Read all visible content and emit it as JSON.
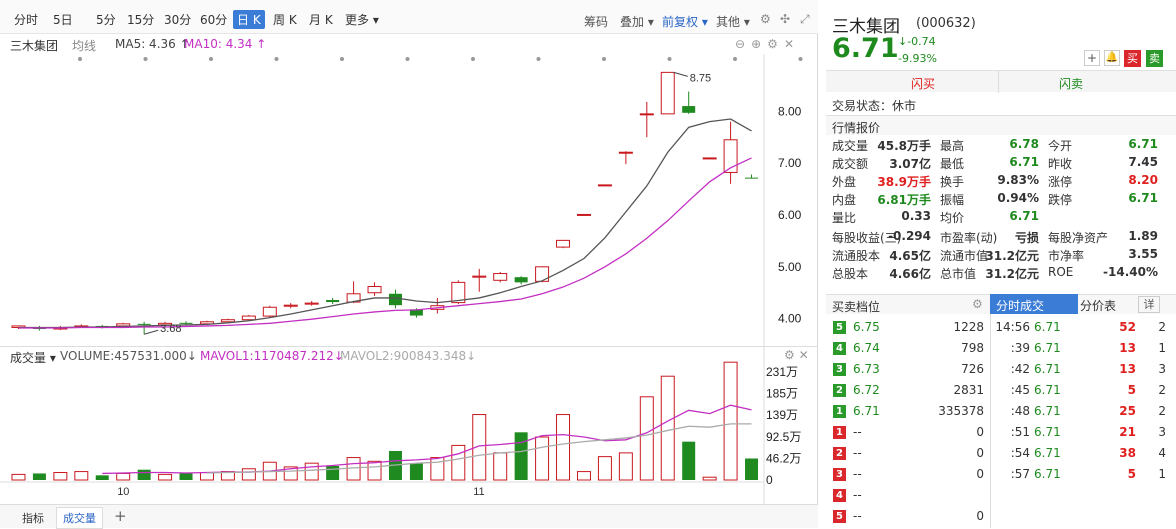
{
  "toolbar": {
    "periods": [
      "分时",
      "5日",
      "5分",
      "15分",
      "30分",
      "60分",
      "日 K",
      "周 K",
      "月 K",
      "更多"
    ],
    "selected": "日 K",
    "right_items": [
      "筹码",
      "叠加",
      "前复权",
      "其他"
    ]
  },
  "ma_line": {
    "name": "三木集团",
    "avg_label": "均线",
    "ma5": "MA5: 4.36 ↑",
    "ma10": "MA10: 4.34 ↑"
  },
  "vol_header": {
    "title": "成交量",
    "volume": "VOLUME:457531.000↓",
    "mavol1": "MAVOL1:1170487.212↓",
    "mavol2": "MAVOL2:900843.348↓"
  },
  "bottom_tabs": [
    "指标",
    "成交量"
  ],
  "chart_data": {
    "type": "candlestick",
    "price_axis": {
      "ticks": [
        "8.00",
        "7.00",
        "6.00",
        "5.00",
        "4.00"
      ],
      "ylim": [
        3.55,
        8.95
      ]
    },
    "volume_axis": {
      "ticks": [
        "231万",
        "185万",
        "139万",
        "92.5万",
        "46.2万",
        "0"
      ],
      "ylim": [
        0,
        231
      ]
    },
    "x_labels": [
      "10",
      "11"
    ],
    "annotations": {
      "high": "8.75",
      "low": "3.68"
    },
    "candles": [
      {
        "o": 3.83,
        "c": 3.86,
        "h": 3.87,
        "l": 3.8,
        "v": 12
      },
      {
        "o": 3.82,
        "c": 3.8,
        "h": 3.86,
        "l": 3.77,
        "v": 14
      },
      {
        "o": 3.8,
        "c": 3.83,
        "h": 3.86,
        "l": 3.78,
        "v": 16
      },
      {
        "o": 3.84,
        "c": 3.86,
        "h": 3.89,
        "l": 3.82,
        "v": 18
      },
      {
        "o": 3.86,
        "c": 3.85,
        "h": 3.88,
        "l": 3.81,
        "v": 10
      },
      {
        "o": 3.86,
        "c": 3.9,
        "h": 3.92,
        "l": 3.84,
        "v": 14
      },
      {
        "o": 3.9,
        "c": 3.88,
        "h": 3.94,
        "l": 3.7,
        "v": 22
      },
      {
        "o": 3.88,
        "c": 3.91,
        "h": 3.94,
        "l": 3.86,
        "v": 12
      },
      {
        "o": 3.92,
        "c": 3.9,
        "h": 3.95,
        "l": 3.88,
        "v": 14
      },
      {
        "o": 3.9,
        "c": 3.94,
        "h": 3.96,
        "l": 3.88,
        "v": 16
      },
      {
        "o": 3.94,
        "c": 3.98,
        "h": 4.0,
        "l": 3.92,
        "v": 18
      },
      {
        "o": 3.98,
        "c": 4.05,
        "h": 4.07,
        "l": 3.96,
        "v": 24
      },
      {
        "o": 4.05,
        "c": 4.22,
        "h": 4.25,
        "l": 4.02,
        "v": 38
      },
      {
        "o": 4.24,
        "c": 4.26,
        "h": 4.3,
        "l": 4.2,
        "v": 28
      },
      {
        "o": 4.28,
        "c": 4.3,
        "h": 4.34,
        "l": 4.25,
        "v": 36
      },
      {
        "o": 4.36,
        "c": 4.32,
        "h": 4.4,
        "l": 4.28,
        "v": 30
      },
      {
        "o": 4.32,
        "c": 4.48,
        "h": 4.72,
        "l": 4.3,
        "v": 48
      },
      {
        "o": 4.5,
        "c": 4.62,
        "h": 4.7,
        "l": 4.44,
        "v": 40
      },
      {
        "o": 4.48,
        "c": 4.26,
        "h": 4.56,
        "l": 4.2,
        "v": 62
      },
      {
        "o": 4.18,
        "c": 4.06,
        "h": 4.2,
        "l": 4.02,
        "v": 36
      },
      {
        "o": 4.18,
        "c": 4.25,
        "h": 4.4,
        "l": 4.1,
        "v": 48
      },
      {
        "o": 4.31,
        "c": 4.7,
        "h": 4.74,
        "l": 4.28,
        "v": 74
      },
      {
        "o": 4.8,
        "c": 4.82,
        "h": 4.96,
        "l": 4.52,
        "v": 140
      },
      {
        "o": 4.74,
        "c": 4.87,
        "h": 4.9,
        "l": 4.7,
        "v": 58
      },
      {
        "o": 4.8,
        "c": 4.7,
        "h": 4.82,
        "l": 4.66,
        "v": 102
      },
      {
        "o": 4.72,
        "c": 5.0,
        "h": 5.01,
        "l": 4.7,
        "v": 92
      },
      {
        "o": 5.38,
        "c": 5.51,
        "h": 5.52,
        "l": 5.36,
        "v": 140
      },
      {
        "o": 6.01,
        "c": 6.01,
        "h": 6.01,
        "l": 6.01,
        "v": 18
      },
      {
        "o": 6.58,
        "c": 6.58,
        "h": 6.58,
        "l": 6.58,
        "v": 50
      },
      {
        "o": 7.21,
        "c": 7.21,
        "h": 7.23,
        "l": 6.98,
        "v": 58
      },
      {
        "o": 7.95,
        "c": 7.95,
        "h": 8.18,
        "l": 7.5,
        "v": 178
      },
      {
        "o": 7.95,
        "c": 8.75,
        "h": 8.75,
        "l": 7.95,
        "v": 222
      },
      {
        "o": 8.1,
        "c": 7.97,
        "h": 8.38,
        "l": 7.95,
        "v": 82
      },
      {
        "o": 7.1,
        "c": 7.1,
        "h": 7.1,
        "l": 7.1,
        "v": 6
      },
      {
        "o": 6.82,
        "c": 7.45,
        "h": 7.8,
        "l": 6.6,
        "v": 252
      },
      {
        "o": 6.72,
        "c": 6.71,
        "h": 6.78,
        "l": 6.71,
        "v": 46
      }
    ],
    "ma5": [
      3.83,
      3.83,
      3.83,
      3.84,
      3.84,
      3.85,
      3.86,
      3.87,
      3.88,
      3.89,
      3.92,
      3.96,
      4.02,
      4.09,
      4.17,
      4.25,
      4.33,
      4.4,
      4.4,
      4.34,
      4.31,
      4.35,
      4.4,
      4.5,
      4.62,
      4.73,
      4.93,
      5.16,
      5.56,
      6.06,
      6.56,
      7.21,
      7.69,
      7.8,
      7.85,
      7.62
    ],
    "ma10": [
      3.82,
      3.82,
      3.82,
      3.83,
      3.83,
      3.83,
      3.84,
      3.84,
      3.85,
      3.86,
      3.87,
      3.89,
      3.91,
      3.95,
      3.99,
      4.04,
      4.09,
      4.13,
      4.16,
      4.17,
      4.21,
      4.25,
      4.29,
      4.33,
      4.38,
      4.48,
      4.61,
      4.78,
      5.0,
      5.25,
      5.55,
      5.89,
      6.27,
      6.64,
      6.91,
      7.1
    ],
    "mavol1": [
      null,
      null,
      null,
      null,
      14,
      15,
      16,
      16,
      15,
      16,
      17,
      17,
      19,
      24,
      28,
      31,
      35,
      37,
      41,
      43,
      46,
      56,
      73,
      76,
      80,
      95,
      97,
      92,
      84,
      86,
      101,
      126,
      149,
      142,
      160,
      150
    ],
    "mavol2": [
      null,
      null,
      null,
      null,
      null,
      null,
      null,
      null,
      null,
      15,
      16,
      17,
      18,
      19,
      21,
      23,
      26,
      28,
      32,
      36,
      38,
      45,
      53,
      58,
      61,
      70,
      77,
      82,
      86,
      90,
      96,
      106,
      115,
      113,
      120,
      120
    ]
  },
  "quote": {
    "name": "三木集团",
    "code": "(000632)",
    "price": "6.71",
    "change": "↓-0.74",
    "change_pct": "-9.93%",
    "buy_btn": "买",
    "sell_btn": "卖",
    "flash_buy": "闪买",
    "flash_sell": "闪卖",
    "status_label": "交易状态：",
    "status": "休市",
    "section_title": "行情报价",
    "rows": [
      [
        [
          "成交量",
          "45.8万手",
          ""
        ],
        [
          "最高",
          "6.78",
          "g"
        ],
        [
          "今开",
          "6.71",
          "g"
        ]
      ],
      [
        [
          "成交额",
          "3.07亿",
          ""
        ],
        [
          "最低",
          "6.71",
          "g"
        ],
        [
          "昨收",
          "7.45",
          ""
        ]
      ],
      [
        [
          "外盘",
          "38.9万手",
          "r"
        ],
        [
          "换手",
          "9.83%",
          ""
        ],
        [
          "涨停",
          "8.20",
          "r"
        ]
      ],
      [
        [
          "内盘",
          "6.81万手",
          "g"
        ],
        [
          "振幅",
          "0.94%",
          ""
        ],
        [
          "跌停",
          "6.71",
          "g"
        ]
      ],
      [
        [
          "量比",
          "0.33",
          ""
        ],
        [
          "均价",
          "6.71",
          "g"
        ],
        [
          "",
          ""
        ]
      ]
    ],
    "rows2": [
      [
        [
          "每股收益(三)",
          "-0.294"
        ],
        [
          "市盈率(动)",
          "亏损"
        ],
        [
          "每股净资产",
          "1.89"
        ]
      ],
      [
        [
          "流通股本",
          "4.65亿"
        ],
        [
          "流通市值",
          "31.2亿元"
        ],
        [
          "市净率",
          "3.55"
        ]
      ],
      [
        [
          "总股本",
          "4.66亿"
        ],
        [
          "总市值",
          "31.2亿元"
        ],
        [
          "ROE",
          "-14.40%"
        ]
      ]
    ]
  },
  "orderbook": {
    "title": "买卖档位",
    "rows": [
      {
        "lvl": "5",
        "side": "g",
        "price": "6.75",
        "vol": "1228"
      },
      {
        "lvl": "4",
        "side": "g",
        "price": "6.74",
        "vol": "798"
      },
      {
        "lvl": "3",
        "side": "g",
        "price": "6.73",
        "vol": "726"
      },
      {
        "lvl": "2",
        "side": "g",
        "price": "6.72",
        "vol": "2831"
      },
      {
        "lvl": "1",
        "side": "g",
        "price": "6.71",
        "vol": "335378"
      },
      {
        "lvl": "1",
        "side": "r",
        "price": "--",
        "vol": "0"
      },
      {
        "lvl": "2",
        "side": "r",
        "price": "--",
        "vol": "0"
      },
      {
        "lvl": "3",
        "side": "r",
        "price": "--",
        "vol": "0"
      },
      {
        "lvl": "4",
        "side": "r",
        "price": "--",
        "vol": ""
      },
      {
        "lvl": "5",
        "side": "r",
        "price": "--",
        "vol": "0"
      }
    ]
  },
  "trades": {
    "tab1": "分时成交",
    "tab2": "分价表",
    "detail": "详",
    "rows": [
      {
        "t": "14:56",
        "p": "6.71",
        "v": "52",
        "n": "2"
      },
      {
        "t": ":39",
        "p": "6.71",
        "v": "13",
        "n": "1"
      },
      {
        "t": ":42",
        "p": "6.71",
        "v": "13",
        "n": "3"
      },
      {
        "t": ":45",
        "p": "6.71",
        "v": "5",
        "n": "2"
      },
      {
        "t": ":48",
        "p": "6.71",
        "v": "25",
        "n": "2"
      },
      {
        "t": ":51",
        "p": "6.71",
        "v": "21",
        "n": "3"
      },
      {
        "t": ":54",
        "p": "6.71",
        "v": "38",
        "n": "4"
      },
      {
        "t": ":57",
        "p": "6.71",
        "v": "5",
        "n": "1"
      }
    ]
  },
  "colors": {
    "up": "#c8181e",
    "down": "#1f8a1f",
    "ma5": "#555555",
    "ma10": "#c32fc3",
    "accent": "#3b7cd6"
  }
}
